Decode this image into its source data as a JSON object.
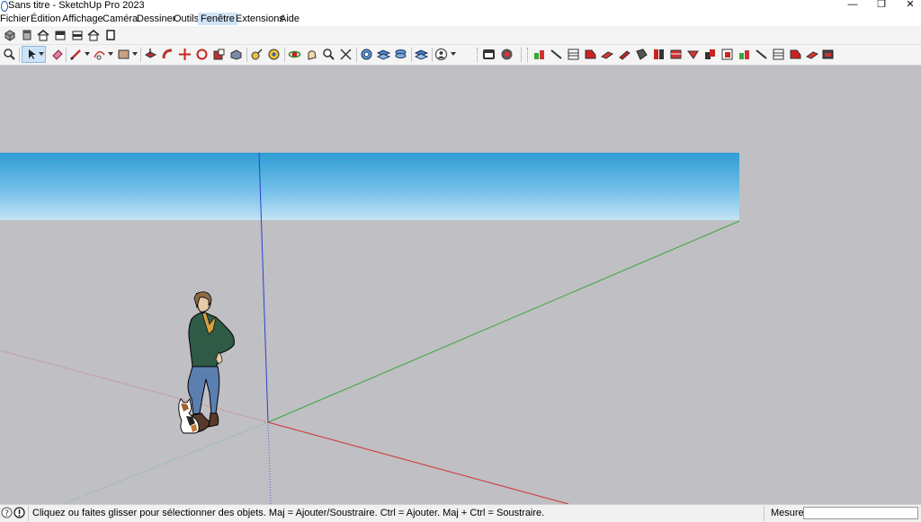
{
  "window": {
    "title": "Sans titre - SketchUp Pro 2023",
    "minimize_glyph": "—",
    "restore_glyph": "❐",
    "close_glyph": "✕"
  },
  "menu": {
    "items": [
      {
        "label": "Fichier"
      },
      {
        "label": "Édition"
      },
      {
        "label": "Affichage"
      },
      {
        "label": "Caméra"
      },
      {
        "label": "Dessiner"
      },
      {
        "label": "Outils"
      },
      {
        "label": "Fenêtre"
      },
      {
        "label": "Extensions"
      },
      {
        "label": "Aide"
      }
    ],
    "active": "Fenêtre"
  },
  "toolbar_views": [
    "iso-view-icon",
    "top-view-icon",
    "front-view-icon",
    "right-view-icon",
    "back-view-icon",
    "left-view-icon"
  ],
  "toolbar_main": [
    "zoom-extents-icon",
    "select-arrow-icon",
    "eraser-icon",
    "pencil-line-icon",
    "freehand-arc-icon",
    "shape-rectangle-icon",
    "push-pull-icon",
    "follow-me-icon",
    "move-icon",
    "rotate-icon",
    "scale-icon",
    "offset-icon",
    "tape-measure-icon",
    "paint-bucket-icon",
    "orbit-icon",
    "pan-icon",
    "zoom-icon",
    "zoom-window-icon",
    "section-plane-icon",
    "section-cuts-icon",
    "section-fill-icon",
    "layers-icon",
    "account-icon"
  ],
  "toolbar_extension": [
    "warehouse-icon",
    "extension-manager-icon"
  ],
  "toolbar_sandbox_count": 20,
  "axes_colors": {
    "red": "#d12f2f",
    "green": "#3aa83a",
    "blue": "#2f3fc8"
  },
  "status": {
    "text": "Cliquez ou faites glisser pour sélectionner des objets. Maj = Ajouter/Soustraire. Ctrl = Ajouter. Maj + Ctrl = Soustraire.",
    "measurements_label": "Mesures",
    "measurements_value": ""
  }
}
